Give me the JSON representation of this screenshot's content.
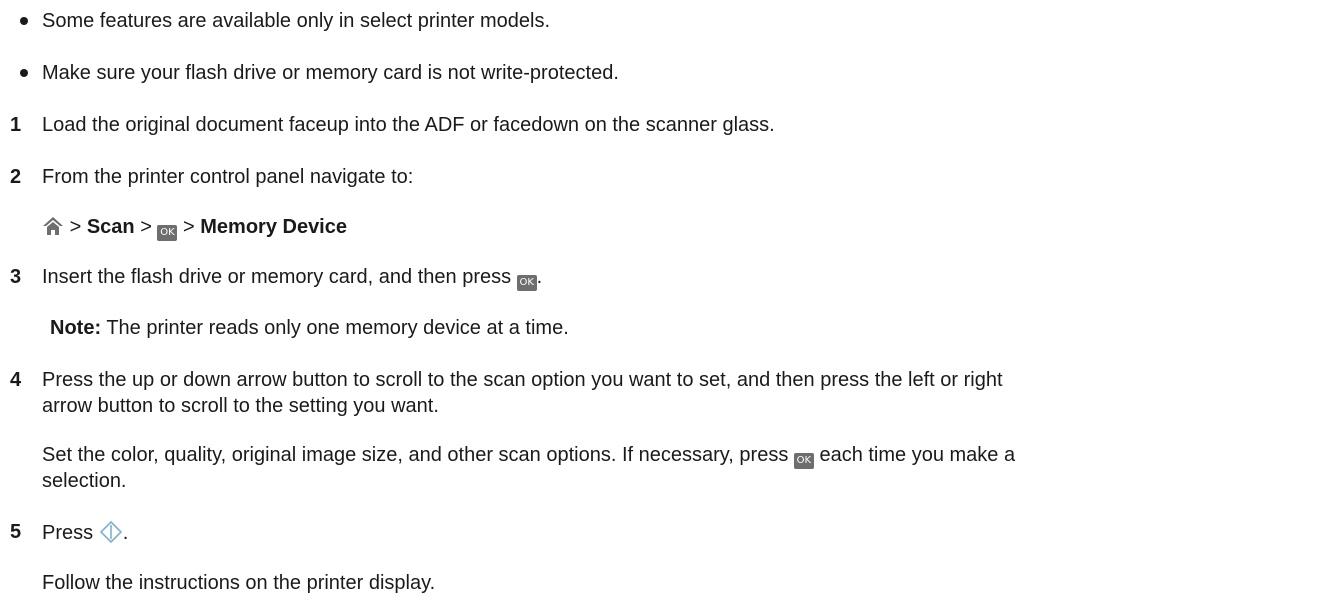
{
  "bullets": [
    "Some features are available only in select printer models.",
    "Make sure your flash drive or memory card is not write-protected."
  ],
  "steps": {
    "s1": {
      "number": "1",
      "text": "Load the original document faceup into the ADF or facedown on the scanner glass."
    },
    "s2": {
      "number": "2",
      "text": "From the printer control panel navigate to:",
      "path": {
        "sep": ">",
        "scan": "Scan",
        "device": "Memory Device"
      }
    },
    "s3": {
      "number": "3",
      "text": "Insert the flash drive or memory card, and then press",
      "end": ".",
      "note_label": "Note:",
      "note_text": "The printer reads only one memory device at a time."
    },
    "s4": {
      "number": "4",
      "line1": "Press the up or down arrow button to scroll to the scan option you want to set, and then press the left or right",
      "line2": "arrow button to scroll to the setting you want.",
      "para_a": "Set the color, quality, original image size, and other scan options. If necessary, press",
      "para_b": "each time you make a",
      "para_c": "selection."
    },
    "s5": {
      "number": "5",
      "text": "Press",
      "end": ".",
      "follow": "Follow the instructions on the printer display."
    }
  },
  "icons": {
    "ok_label": "OK",
    "home": "home-icon",
    "start": "start-icon"
  },
  "colors": {
    "text": "#1a1a1a",
    "icon_gray": "#6e6e6e",
    "start_icon": "#7ab2d6"
  }
}
